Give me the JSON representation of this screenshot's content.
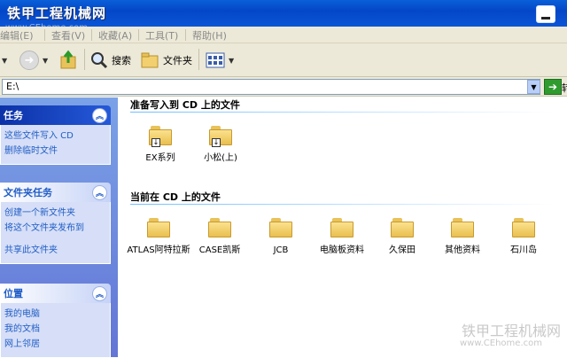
{
  "window": {
    "title": "铁甲工程机械网",
    "watermark_url": "www.CEhome.com"
  },
  "menubar": {
    "items": [
      "编辑(E)",
      "查看(V)",
      "收藏(A)",
      "工具(T)",
      "帮助(H)"
    ]
  },
  "toolbar": {
    "search_label": "搜索",
    "folders_label": "文件夹"
  },
  "address": {
    "value": "E:\\",
    "go_label": "转"
  },
  "sidebar": {
    "panels": [
      {
        "title": "任务",
        "links": [
          "这些文件写入 CD",
          "删除临时文件"
        ]
      },
      {
        "title": "文件夹任务",
        "links": [
          "创建一个新文件夹",
          "将这个文件夹发布到",
          "共享此文件夹"
        ]
      },
      {
        "title": "位置",
        "links": [
          "我的电脑",
          "我的文档",
          "网上邻居"
        ]
      }
    ]
  },
  "content": {
    "pending_title": "准备写入到 CD 上的文件",
    "pending_files": [
      "EX系列",
      "小松(上)"
    ],
    "current_title": "当前在 CD 上的文件",
    "current_files": [
      "ATLAS阿特拉斯",
      "CASE凯斯",
      "JCB",
      "电脑板资料",
      "久保田",
      "其他资料",
      "石川岛"
    ]
  },
  "watermark": {
    "logo": "铁甲工程机械网",
    "url": "www.CEhome.com"
  },
  "colors": {
    "title_bar": "#0a55d6",
    "task_link": "#215dc6",
    "sidebar": "#7ba2e7"
  }
}
